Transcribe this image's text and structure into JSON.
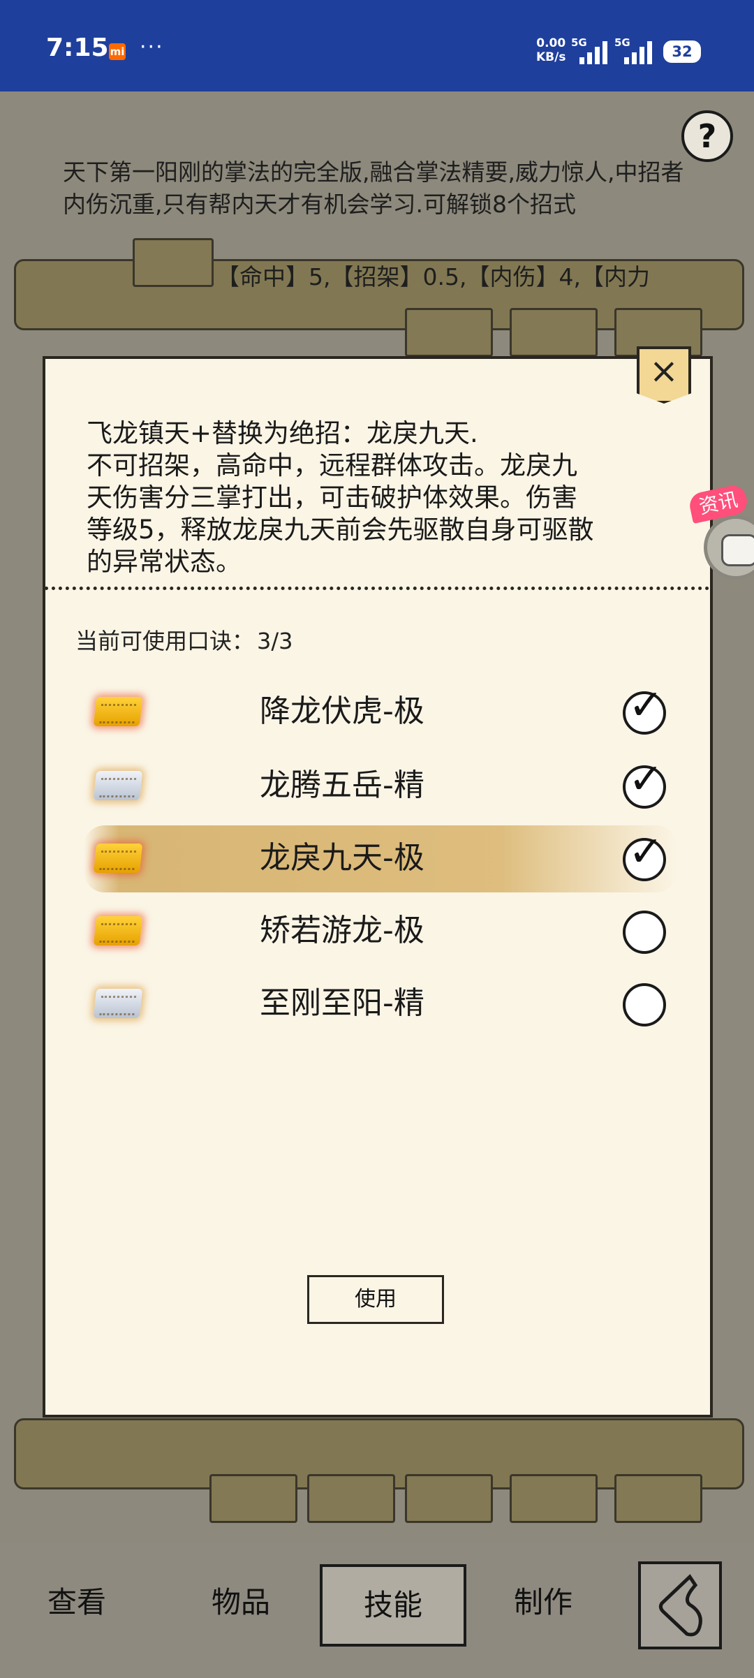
{
  "status_bar": {
    "time": "7:15",
    "dots": "···",
    "speed_top": "0.00",
    "speed_unit": "KB/s",
    "net1": "5G",
    "net2": "5G",
    "battery": "32"
  },
  "background": {
    "help_icon": "?",
    "description": "天下第一阳刚的掌法的完全版,融合掌法精要,威力惊人,中招者内伤沉重,只有帮内天才有机会学习.可解锁8个招式",
    "stats": "【命中】5,【招架】0.5,【内伤】4,【内力"
  },
  "dialog": {
    "close_label": "×",
    "description_lines": [
      "飞龙镇天+替换为绝招：龙戾九天.",
      "不可招架，高命中，远程群体攻击。龙戾九",
      "天伤害分三掌打出，可击破护体效果。伤害",
      "等级5，释放龙戾九天前会先驱散自身可驱散",
      "的异常状态。"
    ],
    "count_label": "当前可使用口诀：",
    "count_value": "3/3",
    "items": [
      {
        "name": "降龙伏虎-极",
        "tier": "gold",
        "checked": true,
        "selected": false
      },
      {
        "name": "龙腾五岳-精",
        "tier": "silver",
        "checked": true,
        "selected": false
      },
      {
        "name": "龙戾九天-极",
        "tier": "gold",
        "checked": true,
        "selected": true
      },
      {
        "name": "矫若游龙-极",
        "tier": "gold",
        "checked": false,
        "selected": false
      },
      {
        "name": "至刚至阳-精",
        "tier": "silver",
        "checked": false,
        "selected": false
      }
    ],
    "use_button": "使用"
  },
  "floating_widget": {
    "badge": "资讯"
  },
  "bottom_nav": {
    "items": [
      "查看",
      "物品",
      "技能",
      "制作"
    ],
    "active": "技能"
  }
}
